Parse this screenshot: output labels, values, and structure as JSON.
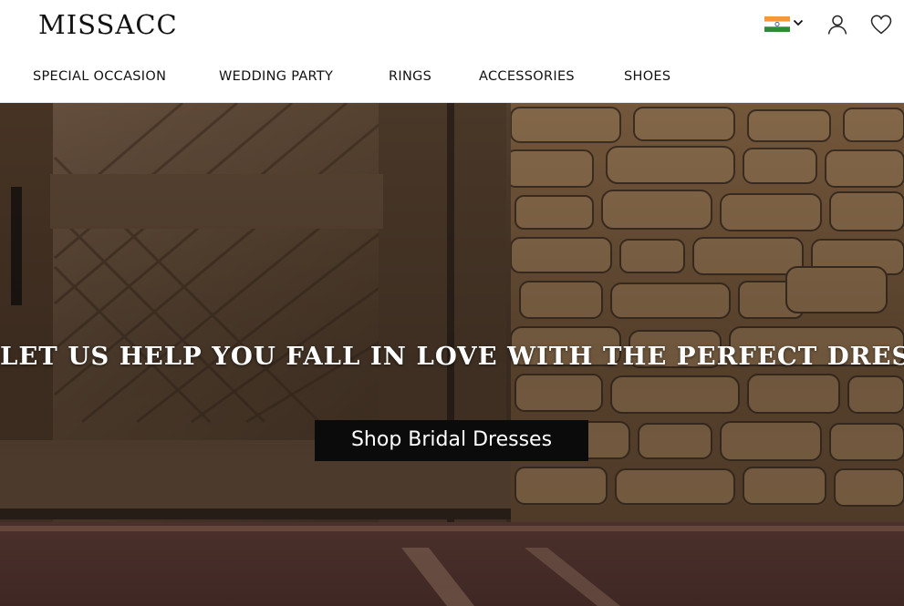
{
  "brand": {
    "logo_text": "MISSACC"
  },
  "nav": {
    "items": [
      {
        "label": "SPECIAL OCCASION"
      },
      {
        "label": "WEDDING PARTY"
      },
      {
        "label": "RINGS"
      },
      {
        "label": "ACCESSORIES"
      },
      {
        "label": "SHOES"
      }
    ]
  },
  "header_icons": {
    "region": {
      "icon": "india-flag-icon",
      "dropdown_icon": "chevron-down-icon"
    },
    "account": {
      "icon": "user-icon"
    },
    "wishlist": {
      "icon": "heart-icon"
    }
  },
  "hero": {
    "headline": "LET US HELP YOU FALL IN LOVE WITH THE PERFECT DRESS",
    "cta_label": "Shop Bridal Dresses"
  },
  "colors": {
    "header_bg": "#ffffff",
    "text": "#111111",
    "cta_bg": "#0b0b0b",
    "cta_text": "#ffffff",
    "headline": "#ffffff",
    "flag_saffron": "#f29a3a",
    "flag_green": "#2f8a3a",
    "flag_chakra": "#1c3a8a"
  }
}
